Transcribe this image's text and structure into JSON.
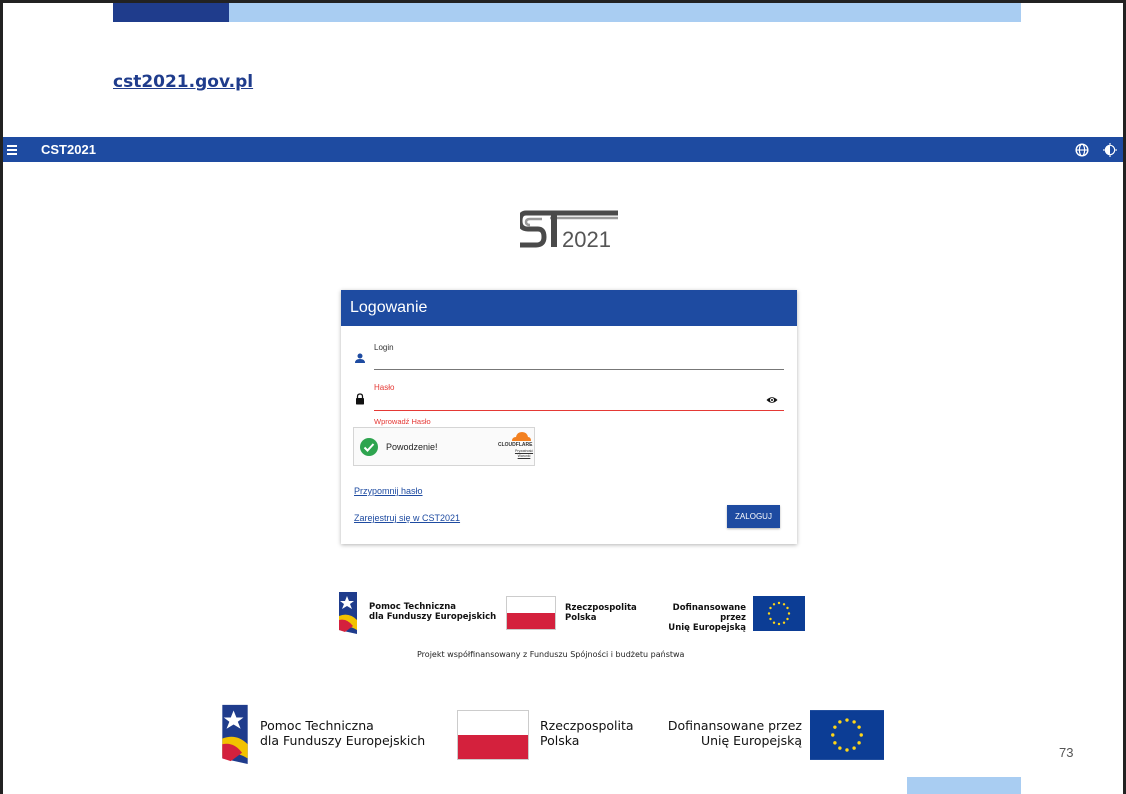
{
  "slide": {
    "link_text": "cst2021.gov.pl",
    "page_number": "73",
    "colors": {
      "dark_blue": "#1f3c8c",
      "light_blue": "#a9cdf2"
    }
  },
  "app": {
    "title": "CST2021",
    "bar_color": "#1e4ba1",
    "icons": {
      "menu": "hamburger-menu-icon",
      "language": "globe-icon",
      "contrast": "contrast-icon"
    },
    "logo_text": "2021"
  },
  "login": {
    "heading": "Logowanie",
    "login_field": {
      "label": "Login",
      "value": "",
      "icon": "person-icon"
    },
    "password_field": {
      "label": "Hasło",
      "value": "",
      "error": "Wprowadź Hasło",
      "icon": "lock-icon",
      "toggle_icon": "eye-icon"
    },
    "captcha": {
      "status": "Powodzenie!",
      "brand": "CLOUDFLARE",
      "links": "Prywatność Warunki"
    },
    "forgot_password": "Przypomnij hasło",
    "register": "Zarejestruj się w CST2021",
    "submit": "ZALOGUJ",
    "error_color": "#e53935"
  },
  "funding": {
    "small": {
      "fe_line1": "Pomoc Techniczna",
      "fe_line2": "dla Funduszy Europejskich",
      "rp_line1": "Rzeczpospolita",
      "rp_line2": "Polska",
      "eu_line1": "Dofinansowane przez",
      "eu_line2": "Unię Europejską",
      "note": "Projekt współfinansowany z Funduszu Spójności i budżetu państwa"
    },
    "large": {
      "fe_line1": "Pomoc Techniczna",
      "fe_line2": "dla Funduszy Europejskich",
      "rp_line1": "Rzeczpospolita",
      "rp_line2": "Polska",
      "eu_line1": "Dofinansowane przez",
      "eu_line2": "Unię Europejską"
    }
  }
}
